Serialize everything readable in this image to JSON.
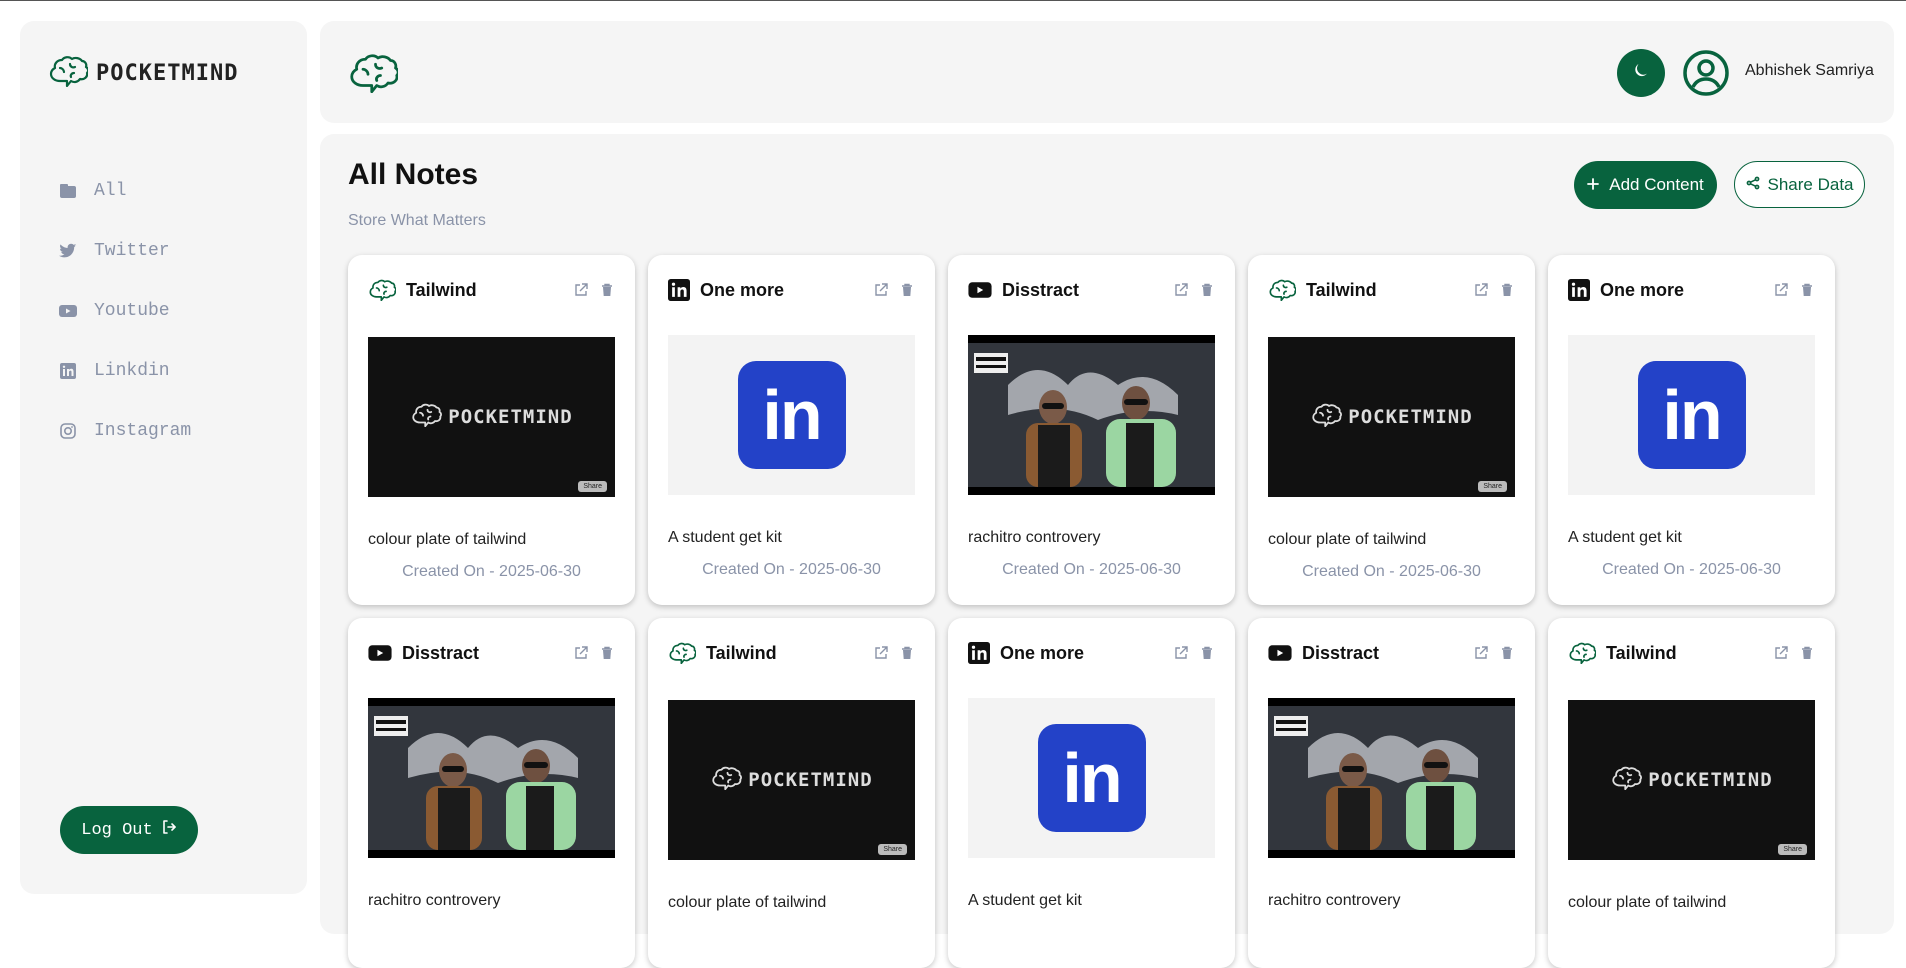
{
  "brand": {
    "name": "POCKETMIND",
    "accent": "#08633e"
  },
  "sidebar": {
    "items": [
      {
        "label": "All",
        "icon": "folder-icon"
      },
      {
        "label": "Twitter",
        "icon": "twitter-icon"
      },
      {
        "label": "Youtube",
        "icon": "youtube-icon"
      },
      {
        "label": "Linkdin",
        "icon": "linkedin-icon"
      },
      {
        "label": "Instagram",
        "icon": "instagram-icon"
      }
    ],
    "logout_label": "Log Out"
  },
  "header": {
    "user_name": "Abhishek Samriya"
  },
  "main": {
    "title": "All Notes",
    "subtitle": "Store What Matters",
    "add_label": "Add Content",
    "share_label": "Share Data"
  },
  "cards": [
    {
      "title": "Tailwind",
      "type": "pocketmind",
      "description": "colour plate of tailwind",
      "date": "Created On - 2025-06-30"
    },
    {
      "title": "One more",
      "type": "linkedin",
      "description": "A student get kit",
      "date": "Created On - 2025-06-30"
    },
    {
      "title": "Disstract",
      "type": "youtube",
      "description": "rachitro controvery",
      "date": "Created On - 2025-06-30"
    },
    {
      "title": "Tailwind",
      "type": "pocketmind",
      "description": "colour plate of tailwind",
      "date": "Created On - 2025-06-30"
    },
    {
      "title": "One more",
      "type": "linkedin",
      "description": "A student get kit",
      "date": "Created On - 2025-06-30"
    },
    {
      "title": "Disstract",
      "type": "youtube",
      "description": "rachitro controvery",
      "date": ""
    },
    {
      "title": "Tailwind",
      "type": "pocketmind",
      "description": "colour plate of tailwind",
      "date": ""
    },
    {
      "title": "One more",
      "type": "linkedin",
      "description": "A student get kit",
      "date": ""
    },
    {
      "title": "Disstract",
      "type": "youtube",
      "description": "rachitro controvery",
      "date": ""
    },
    {
      "title": "Tailwind",
      "type": "pocketmind",
      "description": "colour plate of tailwind",
      "date": ""
    }
  ],
  "thumb_text": {
    "pocketmind": "POCKETMIND",
    "linkedin": "in",
    "share": "Share"
  }
}
